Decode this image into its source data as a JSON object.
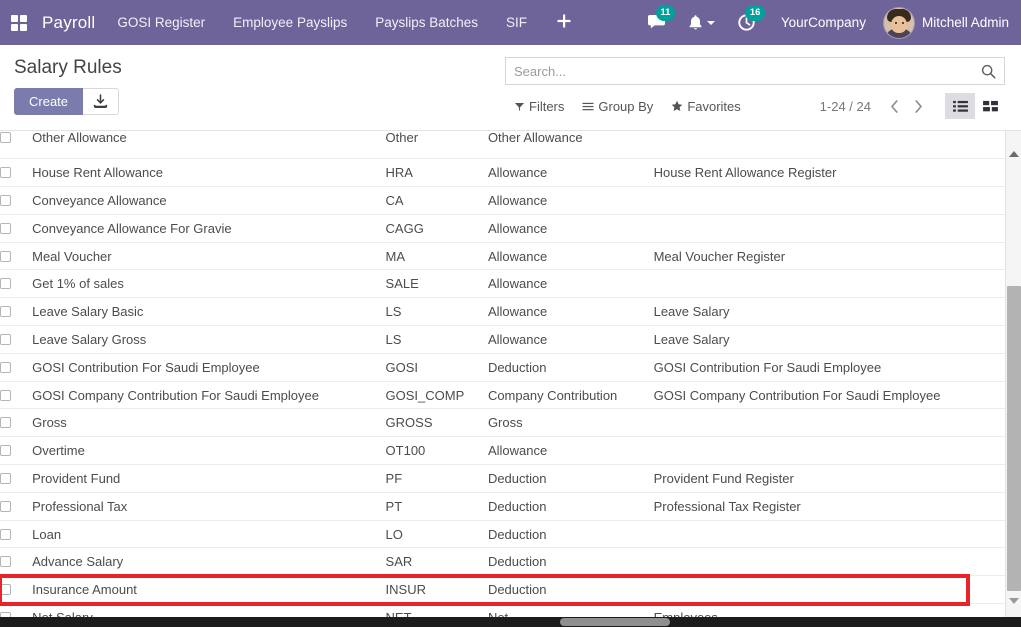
{
  "navbar": {
    "apps_icon": "apps-grid-icon",
    "brand": "Payroll",
    "menus": [
      {
        "label": "GOSI Register"
      },
      {
        "label": "Employee Payslips"
      },
      {
        "label": "Payslips Batches"
      },
      {
        "label": "SIF"
      }
    ],
    "plus_label": "+",
    "messages": {
      "icon": "chat-bubble-icon",
      "count": "11"
    },
    "activities_bell": {
      "icon": "bell-icon"
    },
    "clock": {
      "icon": "clock-icon",
      "count": "16"
    },
    "company": "YourCompany",
    "user": "Mitchell Admin",
    "avatar_icon": "user-avatar",
    "accent_color": "#6e6499",
    "badge_color": "#00a09d"
  },
  "control_panel": {
    "title": "Salary Rules",
    "create_label": "Create",
    "import_icon": "import-download-icon",
    "search": {
      "placeholder": "Search...",
      "value": "",
      "icon": "search-icon"
    },
    "filters_label": "Filters",
    "group_by_label": "Group By",
    "favorites_label": "Favorites",
    "filters_icon": "filter-caret-icon",
    "group_by_icon": "list-lines-icon",
    "favorites_icon": "star-icon",
    "pager": "1-24 / 24",
    "prev_icon": "chevron-left-icon",
    "next_icon": "chevron-right-icon",
    "view_list_icon": "list-view-icon",
    "view_kanban_icon": "kanban-view-icon",
    "active_view": "list"
  },
  "list": {
    "rows": [
      {
        "name": "Other Allowance",
        "code": "Other",
        "category": "Other Allowance",
        "register": "",
        "clipped": true
      },
      {
        "name": "House Rent Allowance",
        "code": "HRA",
        "category": "Allowance",
        "register": "House Rent Allowance Register"
      },
      {
        "name": "Conveyance Allowance",
        "code": "CA",
        "category": "Allowance",
        "register": ""
      },
      {
        "name": "Conveyance Allowance For Gravie",
        "code": "CAGG",
        "category": "Allowance",
        "register": ""
      },
      {
        "name": "Meal Voucher",
        "code": "MA",
        "category": "Allowance",
        "register": "Meal Voucher Register"
      },
      {
        "name": "Get 1% of sales",
        "code": "SALE",
        "category": "Allowance",
        "register": ""
      },
      {
        "name": "Leave Salary Basic",
        "code": "LS",
        "category": "Allowance",
        "register": "Leave Salary"
      },
      {
        "name": "Leave Salary Gross",
        "code": "LS",
        "category": "Allowance",
        "register": "Leave Salary"
      },
      {
        "name": "GOSI Contribution For Saudi Employee",
        "code": "GOSI",
        "category": "Deduction",
        "register": "GOSI Contribution For Saudi Employee"
      },
      {
        "name": "GOSI Company Contribution For Saudi Employee",
        "code": "GOSI_COMP",
        "category": "Company Contribution",
        "register": "GOSI Company Contribution For Saudi Employee"
      },
      {
        "name": "Gross",
        "code": "GROSS",
        "category": "Gross",
        "register": ""
      },
      {
        "name": "Overtime",
        "code": "OT100",
        "category": "Allowance",
        "register": ""
      },
      {
        "name": "Provident Fund",
        "code": "PF",
        "category": "Deduction",
        "register": "Provident Fund Register"
      },
      {
        "name": "Professional Tax",
        "code": "PT",
        "category": "Deduction",
        "register": "Professional Tax Register"
      },
      {
        "name": "Loan",
        "code": "LO",
        "category": "Deduction",
        "register": ""
      },
      {
        "name": "Advance Salary",
        "code": "SAR",
        "category": "Deduction",
        "register": ""
      },
      {
        "name": "Insurance Amount",
        "code": "INSUR",
        "category": "Deduction",
        "register": "",
        "highlighted": true
      },
      {
        "name": "Net Salary",
        "code": "NET",
        "category": "Net",
        "register": "Employees"
      }
    ],
    "highlight_color": "#e8232a"
  }
}
